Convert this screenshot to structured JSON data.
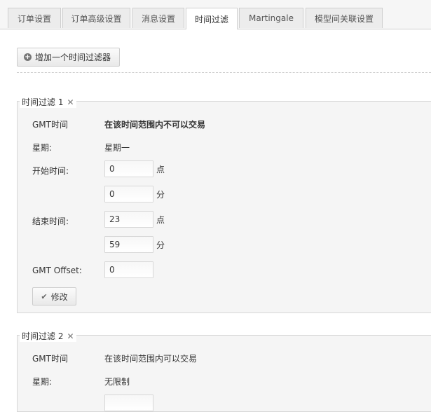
{
  "tabs": [
    "订单设置",
    "订单高级设置",
    "消息设置",
    "时间过滤",
    "Martingale",
    "模型间关联设置"
  ],
  "add_filter_button": "增加一个时间过滤器",
  "filters": [
    {
      "title": "时间过滤 1",
      "gmt_label": "GMT时间",
      "gmt_value": "在该时间范围内不可以交易",
      "weekday_label": "星期:",
      "weekday_value": "星期一",
      "start_label": "开始时间:",
      "start_hour": "0",
      "start_minute": "0",
      "end_label": "结束时间:",
      "end_hour": "23",
      "end_minute": "59",
      "hour_unit": "点",
      "minute_unit": "分",
      "offset_label": "GMT Offset:",
      "offset_value": "0",
      "edit_button": "修改"
    },
    {
      "title": "时间过滤 2",
      "gmt_label": "GMT时间",
      "gmt_value": "在该时间范围内可以交易",
      "weekday_label": "星期:",
      "weekday_value": "无限制"
    }
  ]
}
